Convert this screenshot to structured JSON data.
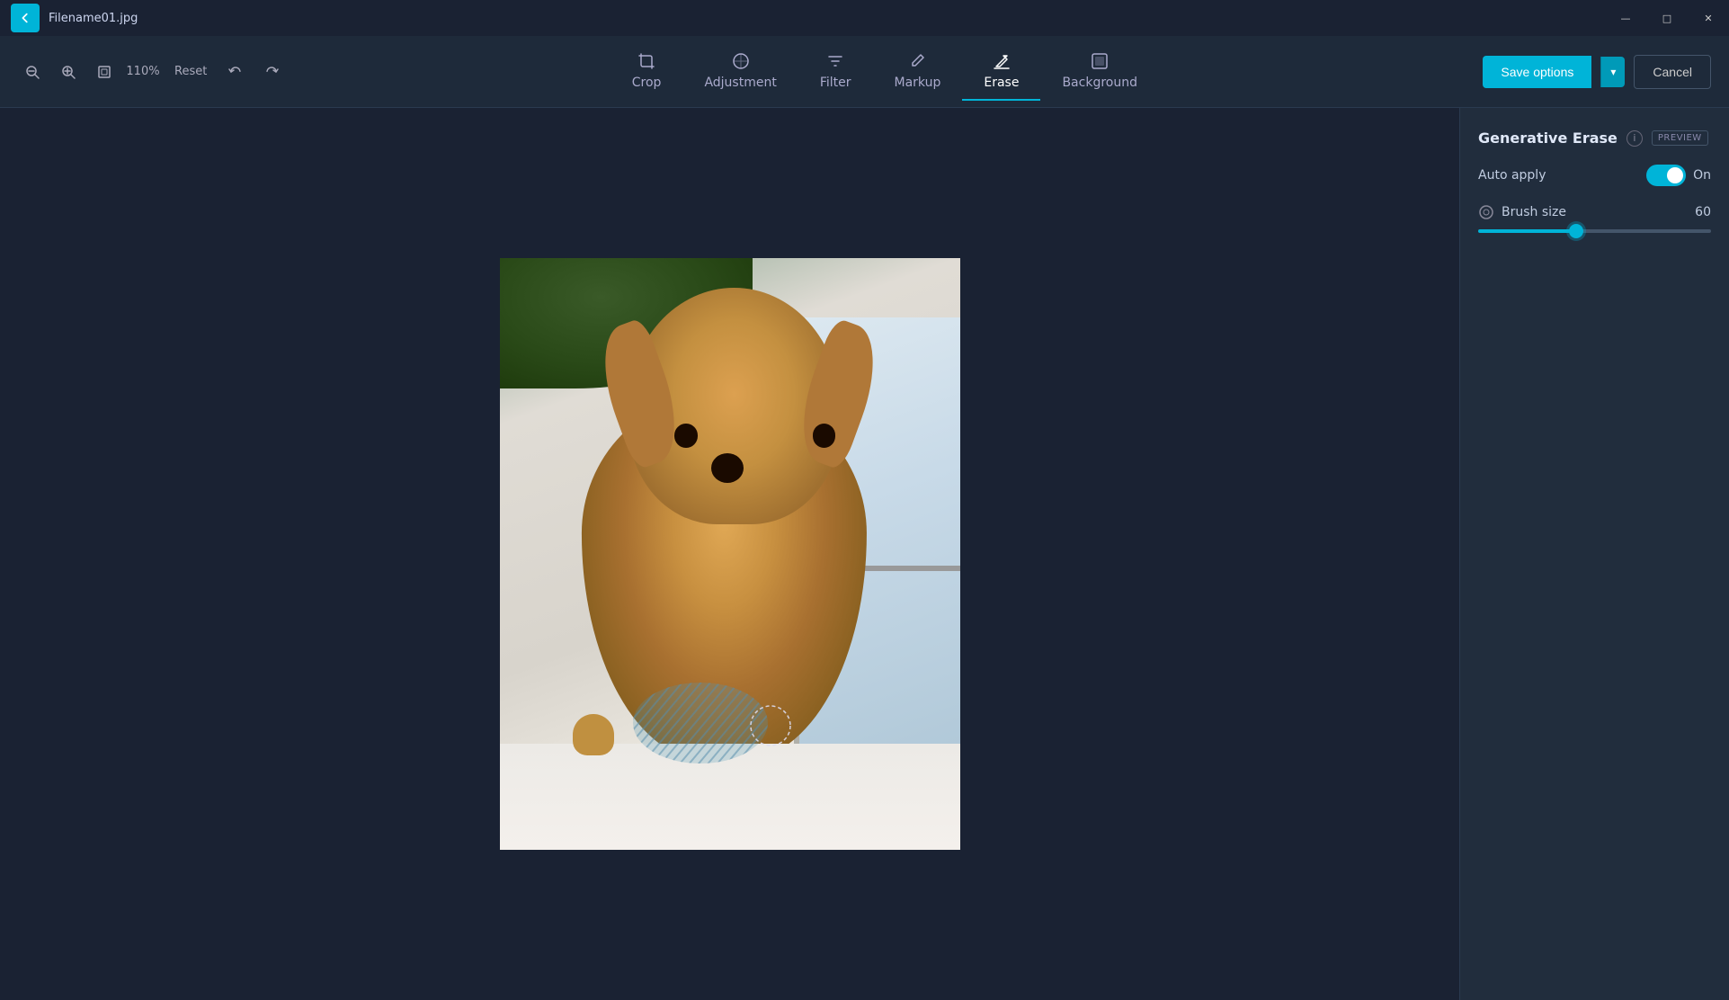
{
  "titlebar": {
    "filename": "Filename01.jpg",
    "back_icon": "←"
  },
  "window_controls": {
    "minimize": "—",
    "maximize": "□",
    "close": "✕"
  },
  "toolbar_left": {
    "zoom_out_icon": "🔍",
    "zoom_in_icon": "+",
    "fit_icon": "⊡",
    "zoom_level": "110%",
    "reset_label": "Reset",
    "undo_icon": "↩",
    "redo_icon": "↪"
  },
  "nav_tools": [
    {
      "id": "crop",
      "label": "Crop",
      "icon": "⊡"
    },
    {
      "id": "adjustment",
      "label": "Adjustment",
      "icon": "⚙"
    },
    {
      "id": "filter",
      "label": "Filter",
      "icon": "🎨"
    },
    {
      "id": "markup",
      "label": "Markup",
      "icon": "✏"
    },
    {
      "id": "erase",
      "label": "Erase",
      "icon": "◻",
      "active": true
    },
    {
      "id": "background",
      "label": "Background",
      "icon": "⬛"
    }
  ],
  "toolbar_right": {
    "save_options_label": "Save options",
    "cancel_label": "Cancel",
    "dropdown_icon": "▾"
  },
  "right_panel": {
    "title": "Generative Erase",
    "info_icon": "i",
    "preview_badge": "PREVIEW",
    "auto_apply_label": "Auto apply",
    "toggle_state": "On",
    "brush_size_label": "Brush size",
    "brush_size_value": "60",
    "slider_percent": 42
  }
}
